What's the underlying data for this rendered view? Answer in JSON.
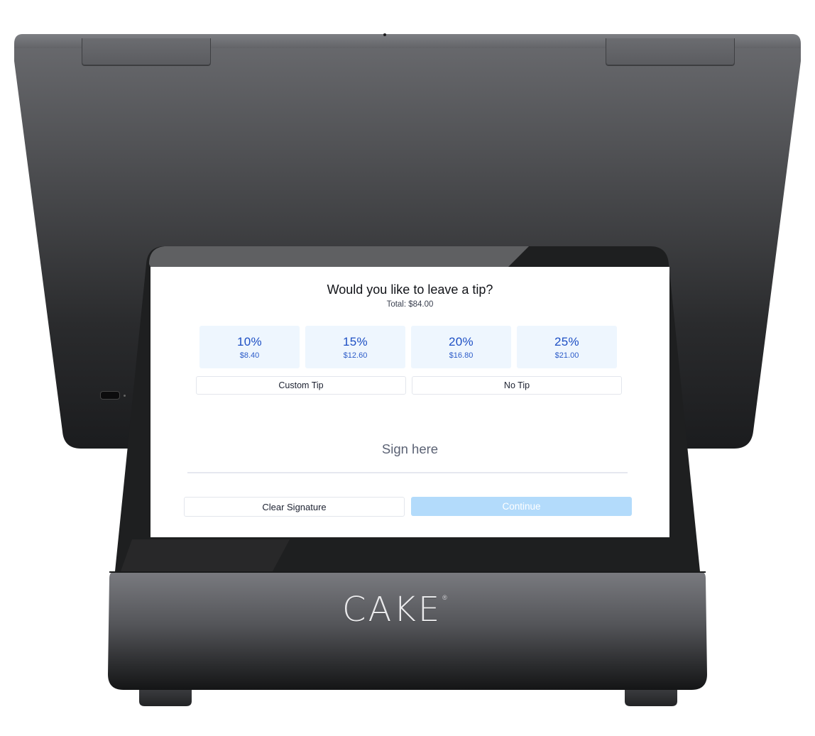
{
  "device": {
    "brand_logo": "CAKE",
    "brand_mark": "®",
    "colors": {
      "body_dark": "#1c1d1f",
      "body_grey": "#6c6d71",
      "accent_blue": "#1d4fc4",
      "tip_bg": "#eef6fe",
      "continue_bg": "#b3dbfb"
    }
  },
  "tip_screen": {
    "title": "Would you like to leave a tip?",
    "total": "Total: $84.00",
    "tip_options": [
      {
        "percent": "10%",
        "amount": "$8.40"
      },
      {
        "percent": "15%",
        "amount": "$12.60"
      },
      {
        "percent": "20%",
        "amount": "$16.80"
      },
      {
        "percent": "25%",
        "amount": "$21.00"
      }
    ],
    "custom_tip_label": "Custom Tip",
    "no_tip_label": "No Tip",
    "signature_prompt": "Sign here",
    "clear_signature_label": "Clear Signature",
    "continue_label": "Continue"
  }
}
